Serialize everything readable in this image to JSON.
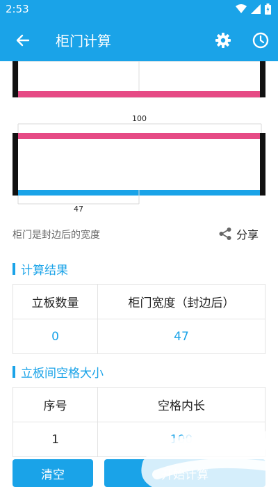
{
  "status_bar": {
    "time": "2:53"
  },
  "app_bar": {
    "title": "柜门计算"
  },
  "diagram": {
    "top_width_label": "100",
    "bottom_width_label": "47",
    "colors": {
      "frame": "#111111",
      "pink": "#e64a85",
      "blue": "#1aa3e8"
    }
  },
  "caption": "柜门是封边后的宽度",
  "share_label": "分享",
  "results": {
    "title": "计算结果",
    "headers": [
      "立板数量",
      "柜门宽度（封边后）"
    ],
    "values": [
      "0",
      "47"
    ]
  },
  "spacing": {
    "title": "立板间空格大小",
    "headers": [
      "序号",
      "空格内长"
    ],
    "rows": [
      [
        "1",
        "100"
      ]
    ]
  },
  "buttons": {
    "clear": "清空",
    "start": "开始计算"
  }
}
